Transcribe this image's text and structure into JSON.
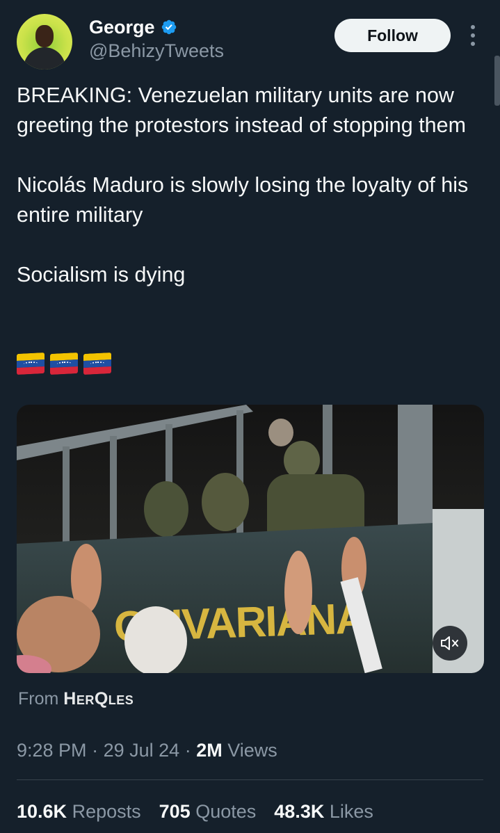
{
  "author": {
    "display_name": "George",
    "handle": "@BehizyTweets",
    "verified": true
  },
  "header": {
    "follow_label": "Follow"
  },
  "tweet": {
    "paragraphs": [
      "BREAKING: Venezuelan military units are now greeting the protestors instead of stopping them",
      "Nicolás Maduro is slowly losing the loyalty of his entire military",
      "Socialism is dying"
    ],
    "emoji": [
      "venezuela-flag",
      "venezuela-flag",
      "venezuela-flag"
    ]
  },
  "media": {
    "type": "video",
    "overlay_text": "OLIVARIANA",
    "muted": true
  },
  "source": {
    "prefix": "From",
    "name": "HerQles"
  },
  "meta": {
    "time": "9:28 PM",
    "date": "29 Jul 24",
    "views_count": "2M",
    "views_label": "Views",
    "separator": "·"
  },
  "stats": {
    "reposts_count": "10.6K",
    "reposts_label": "Reposts",
    "quotes_count": "705",
    "quotes_label": "Quotes",
    "likes_count": "48.3K",
    "likes_label": "Likes"
  },
  "colors": {
    "background": "#15202b",
    "verified_blue": "#1d9bf0",
    "muted_text": "#8b98a5",
    "divider": "#38444d"
  }
}
